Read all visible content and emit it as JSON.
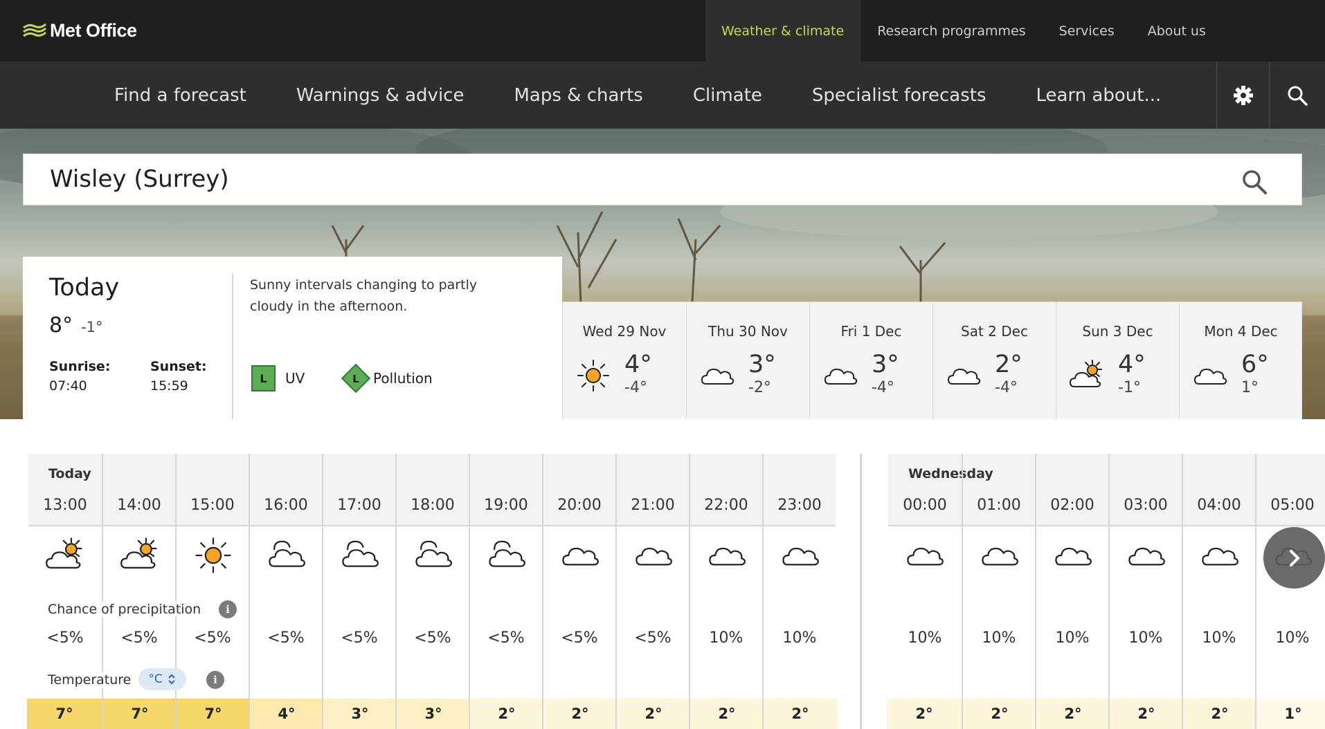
{
  "brand": {
    "name": "Met Office"
  },
  "topnav": {
    "items": [
      {
        "label": "Weather & climate",
        "active": true
      },
      {
        "label": "Research programmes"
      },
      {
        "label": "Services"
      },
      {
        "label": "About us"
      }
    ]
  },
  "mainnav": {
    "items": [
      {
        "label": "Find a forecast"
      },
      {
        "label": "Warnings & advice"
      },
      {
        "label": "Maps & charts"
      },
      {
        "label": "Climate"
      },
      {
        "label": "Specialist forecasts"
      },
      {
        "label": "Learn about..."
      }
    ],
    "settings_icon": "gear-icon",
    "search_icon": "search-icon"
  },
  "search": {
    "value": "Wisley (Surrey)",
    "icon": "search-icon"
  },
  "today": {
    "title": "Today",
    "max": "8°",
    "min": "-1°",
    "sunrise_label": "Sunrise:",
    "sunrise": "07:40",
    "sunset_label": "Sunset:",
    "sunset": "15:59",
    "summary": "Sunny intervals changing to partly cloudy in the afternoon.",
    "uv_badge": "L",
    "uv_label": "UV",
    "pollution_badge": "L",
    "pollution_label": "Pollution",
    "colors": {
      "uv": "#5cae55",
      "pollution": "#5cae55"
    }
  },
  "days": [
    {
      "name": "Wed 29 Nov",
      "max": "4°",
      "min": "-4°",
      "icon": "sunny-icon"
    },
    {
      "name": "Thu 30 Nov",
      "max": "3°",
      "min": "-2°",
      "icon": "cloudy-icon"
    },
    {
      "name": "Fri 1 Dec",
      "max": "3°",
      "min": "-4°",
      "icon": "cloudy-icon"
    },
    {
      "name": "Sat 2 Dec",
      "max": "2°",
      "min": "-4°",
      "icon": "cloudy-icon"
    },
    {
      "name": "Sun 3 Dec",
      "max": "4°",
      "min": "-1°",
      "icon": "sunny-intervals-icon"
    },
    {
      "name": "Mon 4 Dec",
      "max": "6°",
      "min": "1°",
      "icon": "cloudy-icon"
    }
  ],
  "hourly": {
    "precip_label": "Chance of precipitation",
    "temp_label": "Temperature",
    "temp_unit": "°C",
    "sections": [
      {
        "title": "Today",
        "hours": [
          {
            "time": "13:00",
            "icon": "sunny-intervals-icon",
            "precip": "<5%",
            "temp": "7°",
            "temp_color": "#f6d86a"
          },
          {
            "time": "14:00",
            "icon": "sunny-intervals-icon",
            "precip": "<5%",
            "temp": "7°",
            "temp_color": "#f6d86a"
          },
          {
            "time": "15:00",
            "icon": "sunny-icon",
            "precip": "<5%",
            "temp": "7°",
            "temp_color": "#f6d86a"
          },
          {
            "time": "16:00",
            "icon": "partly-cloudy-night-icon",
            "precip": "<5%",
            "temp": "4°",
            "temp_color": "#fbe9ad"
          },
          {
            "time": "17:00",
            "icon": "partly-cloudy-night-icon",
            "precip": "<5%",
            "temp": "3°",
            "temp_color": "#fdf0c4"
          },
          {
            "time": "18:00",
            "icon": "partly-cloudy-night-icon",
            "precip": "<5%",
            "temp": "3°",
            "temp_color": "#fdf0c4"
          },
          {
            "time": "19:00",
            "icon": "partly-cloudy-night-icon",
            "precip": "<5%",
            "temp": "2°",
            "temp_color": "#fef6da"
          },
          {
            "time": "20:00",
            "icon": "cloudy-icon",
            "precip": "<5%",
            "temp": "2°",
            "temp_color": "#fef6da"
          },
          {
            "time": "21:00",
            "icon": "cloudy-icon",
            "precip": "<5%",
            "temp": "2°",
            "temp_color": "#fef6da"
          },
          {
            "time": "22:00",
            "icon": "cloudy-icon",
            "precip": "10%",
            "temp": "2°",
            "temp_color": "#fef6da"
          },
          {
            "time": "23:00",
            "icon": "cloudy-icon",
            "precip": "10%",
            "temp": "2°",
            "temp_color": "#fef6da"
          }
        ]
      },
      {
        "title": "Wednesday",
        "hours": [
          {
            "time": "00:00",
            "icon": "cloudy-icon",
            "precip": "10%",
            "temp": "2°",
            "temp_color": "#fef6da"
          },
          {
            "time": "01:00",
            "icon": "cloudy-icon",
            "precip": "10%",
            "temp": "2°",
            "temp_color": "#fef6da"
          },
          {
            "time": "02:00",
            "icon": "cloudy-icon",
            "precip": "10%",
            "temp": "2°",
            "temp_color": "#fef6da"
          },
          {
            "time": "03:00",
            "icon": "cloudy-icon",
            "precip": "10%",
            "temp": "2°",
            "temp_color": "#fef6da"
          },
          {
            "time": "04:00",
            "icon": "cloudy-icon",
            "precip": "10%",
            "temp": "2°",
            "temp_color": "#fef6da"
          },
          {
            "time": "05:00",
            "icon": "cloudy-icon",
            "precip": "10%",
            "temp": "1°",
            "temp_color": "#fffaea"
          }
        ]
      }
    ],
    "next_icon": "chevron-right-icon"
  }
}
